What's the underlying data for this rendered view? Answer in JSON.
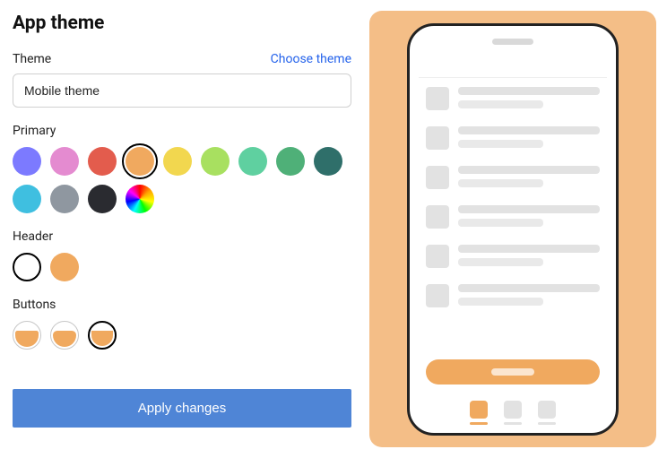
{
  "page": {
    "title": "App theme"
  },
  "theme": {
    "label": "Theme",
    "choose_label": "Choose theme",
    "input_value": "Mobile theme"
  },
  "primary": {
    "label": "Primary",
    "selected_index": 3,
    "colors": [
      "#7c7aff",
      "#e48bd0",
      "#e35c4d",
      "#f0a95f",
      "#f2d74f",
      "#a8e060",
      "#5fd0a0",
      "#4fb078",
      "#2f6f6a",
      "#3fbfe0",
      "#8f97a0",
      "#2a2b30",
      "rainbow"
    ]
  },
  "header": {
    "label": "Header",
    "selected_index": 0,
    "options": [
      "white",
      "accent"
    ]
  },
  "buttons": {
    "label": "Buttons",
    "selected_index": 2,
    "styles": [
      "rounded-small",
      "rounded-medium",
      "pill"
    ]
  },
  "apply": {
    "label": "Apply changes"
  },
  "preview": {
    "accent": "#f0a95f",
    "accent_bg": "#f4be87",
    "list_rows": 6
  }
}
